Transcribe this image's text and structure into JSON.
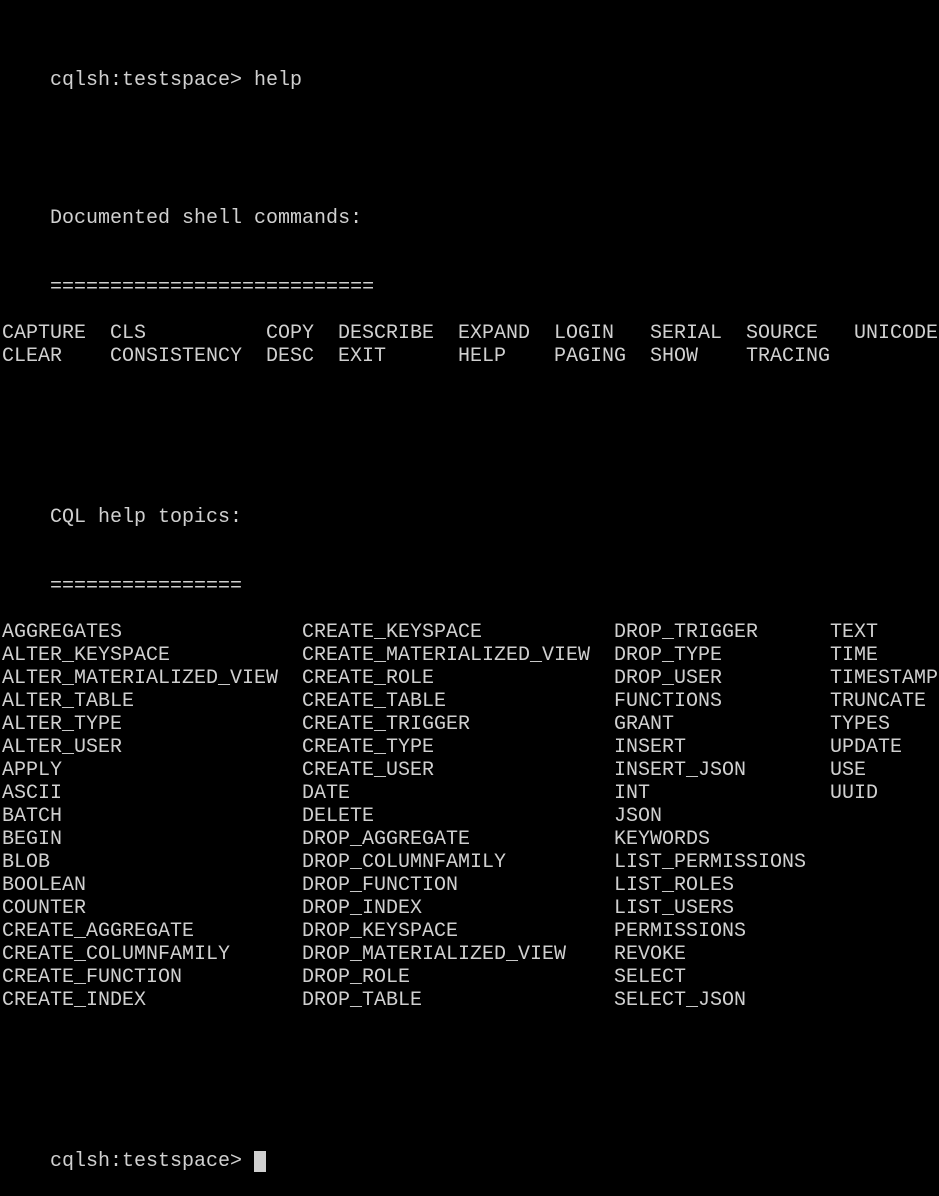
{
  "prompt_top": "cqlsh:testspace> help",
  "shell_section": {
    "heading": "Documented shell commands:",
    "underline": "==========================="
  },
  "shell_commands": [
    [
      "CAPTURE",
      "CLS",
      "COPY",
      "DESCRIBE",
      "EXPAND",
      "LOGIN",
      "SERIAL",
      "SOURCE",
      "UNICODE"
    ],
    [
      "CLEAR",
      "CONSISTENCY",
      "DESC",
      "EXIT",
      "HELP",
      "PAGING",
      "SHOW",
      "TRACING",
      ""
    ]
  ],
  "cql_section": {
    "heading": "CQL help topics:",
    "underline": "================"
  },
  "cql_topics": [
    [
      "AGGREGATES",
      "CREATE_KEYSPACE",
      "DROP_TRIGGER",
      "TEXT"
    ],
    [
      "ALTER_KEYSPACE",
      "CREATE_MATERIALIZED_VIEW",
      "DROP_TYPE",
      "TIME"
    ],
    [
      "ALTER_MATERIALIZED_VIEW",
      "CREATE_ROLE",
      "DROP_USER",
      "TIMESTAMP"
    ],
    [
      "ALTER_TABLE",
      "CREATE_TABLE",
      "FUNCTIONS",
      "TRUNCATE"
    ],
    [
      "ALTER_TYPE",
      "CREATE_TRIGGER",
      "GRANT",
      "TYPES"
    ],
    [
      "ALTER_USER",
      "CREATE_TYPE",
      "INSERT",
      "UPDATE"
    ],
    [
      "APPLY",
      "CREATE_USER",
      "INSERT_JSON",
      "USE"
    ],
    [
      "ASCII",
      "DATE",
      "INT",
      "UUID"
    ],
    [
      "BATCH",
      "DELETE",
      "JSON",
      ""
    ],
    [
      "BEGIN",
      "DROP_AGGREGATE",
      "KEYWORDS",
      ""
    ],
    [
      "BLOB",
      "DROP_COLUMNFAMILY",
      "LIST_PERMISSIONS",
      ""
    ],
    [
      "BOOLEAN",
      "DROP_FUNCTION",
      "LIST_ROLES",
      ""
    ],
    [
      "COUNTER",
      "DROP_INDEX",
      "LIST_USERS",
      ""
    ],
    [
      "CREATE_AGGREGATE",
      "DROP_KEYSPACE",
      "PERMISSIONS",
      ""
    ],
    [
      "CREATE_COLUMNFAMILY",
      "DROP_MATERIALIZED_VIEW",
      "REVOKE",
      ""
    ],
    [
      "CREATE_FUNCTION",
      "DROP_ROLE",
      "SELECT",
      ""
    ],
    [
      "CREATE_INDEX",
      "DROP_TABLE",
      "SELECT_JSON",
      ""
    ]
  ],
  "prompt_bottom": "cqlsh:testspace>",
  "colors": {
    "background": "#000000",
    "foreground": "#d0d0d0"
  }
}
